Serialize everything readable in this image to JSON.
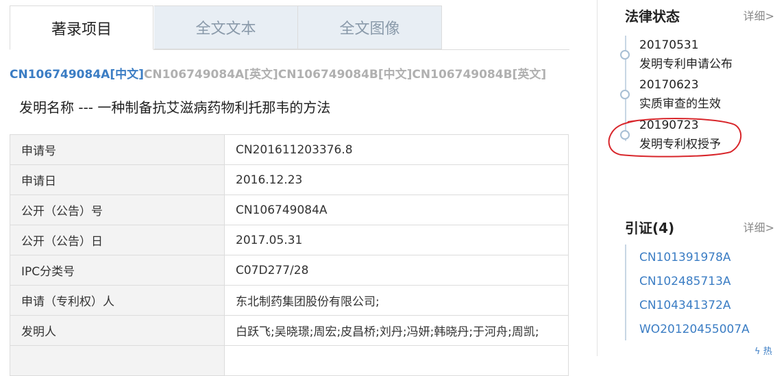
{
  "tabs": [
    "著录项目",
    "全文文本",
    "全文图像"
  ],
  "pub_links": [
    {
      "id": "CN106749084A",
      "lang": "[中文]"
    },
    {
      "id": "CN106749084A",
      "lang": "[英文]"
    },
    {
      "id": "CN106749084B",
      "lang": "[中文]"
    },
    {
      "id": "CN106749084B",
      "lang": "[英文]"
    }
  ],
  "invention": {
    "label": "发明名称",
    "sep": "---",
    "name": "一种制备抗艾滋病药物利托那韦的方法"
  },
  "meta_rows": [
    {
      "key": "申请号",
      "value": "CN201611203376.8"
    },
    {
      "key": "申请日",
      "value": "2016.12.23"
    },
    {
      "key": "公开（公告）号",
      "value": "CN106749084A"
    },
    {
      "key": "公开（公告）日",
      "value": "2017.05.31"
    },
    {
      "key": "IPC分类号",
      "value": "C07D277/28"
    },
    {
      "key": "申请（专利权）人",
      "value": "东北制药集团股份有限公司;"
    },
    {
      "key": "发明人",
      "value": "白跃飞;吴晓璟;周宏;皮昌桥;刘丹;冯妍;韩晓丹;于河舟;周凯;"
    }
  ],
  "legal": {
    "title": "法律状态",
    "more": "详细>",
    "events": [
      {
        "date": "20170531",
        "desc": "发明专利申请公布"
      },
      {
        "date": "20170623",
        "desc": "实质审查的生效"
      },
      {
        "date": "20190723",
        "desc": "发明专利权授予"
      }
    ]
  },
  "citations": {
    "title": "引证(4)",
    "more": "详细>",
    "items": [
      "CN101391978A",
      "CN102485713A",
      "CN104341372A",
      "WO20120455007A"
    ]
  },
  "bottom_icon": "ϟ 热",
  "colors": {
    "link": "#3b7dc4",
    "annotation": "#d8262b"
  }
}
